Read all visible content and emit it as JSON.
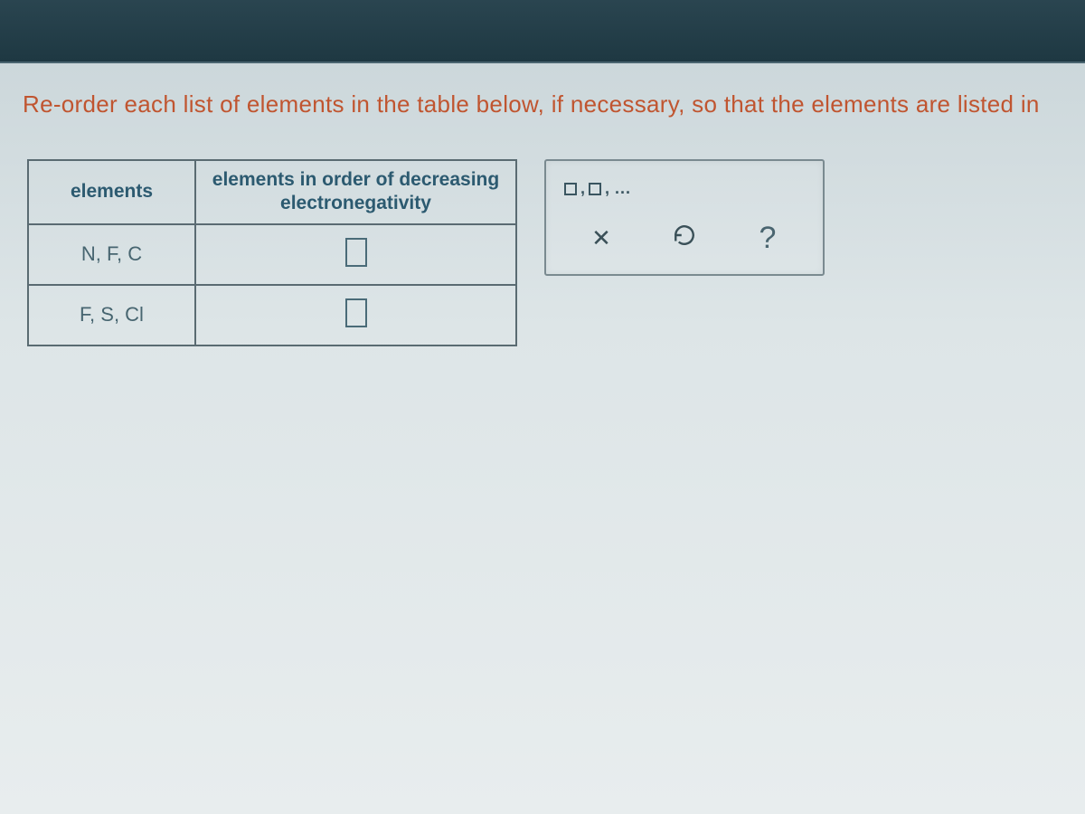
{
  "question": {
    "text": "Re-order each list of elements in the table below, if necessary, so that the elements are listed in"
  },
  "table": {
    "headers": {
      "col1": "elements",
      "col2": "elements in order of decreasing electronegativity"
    },
    "rows": [
      {
        "elements": "N, F, C",
        "input": ""
      },
      {
        "elements": "F, S, Cl",
        "input": ""
      }
    ]
  },
  "toolbox": {
    "pattern_hint": "□,□,...",
    "buttons": {
      "clear": "clear",
      "reset": "reset",
      "help": "help"
    }
  }
}
